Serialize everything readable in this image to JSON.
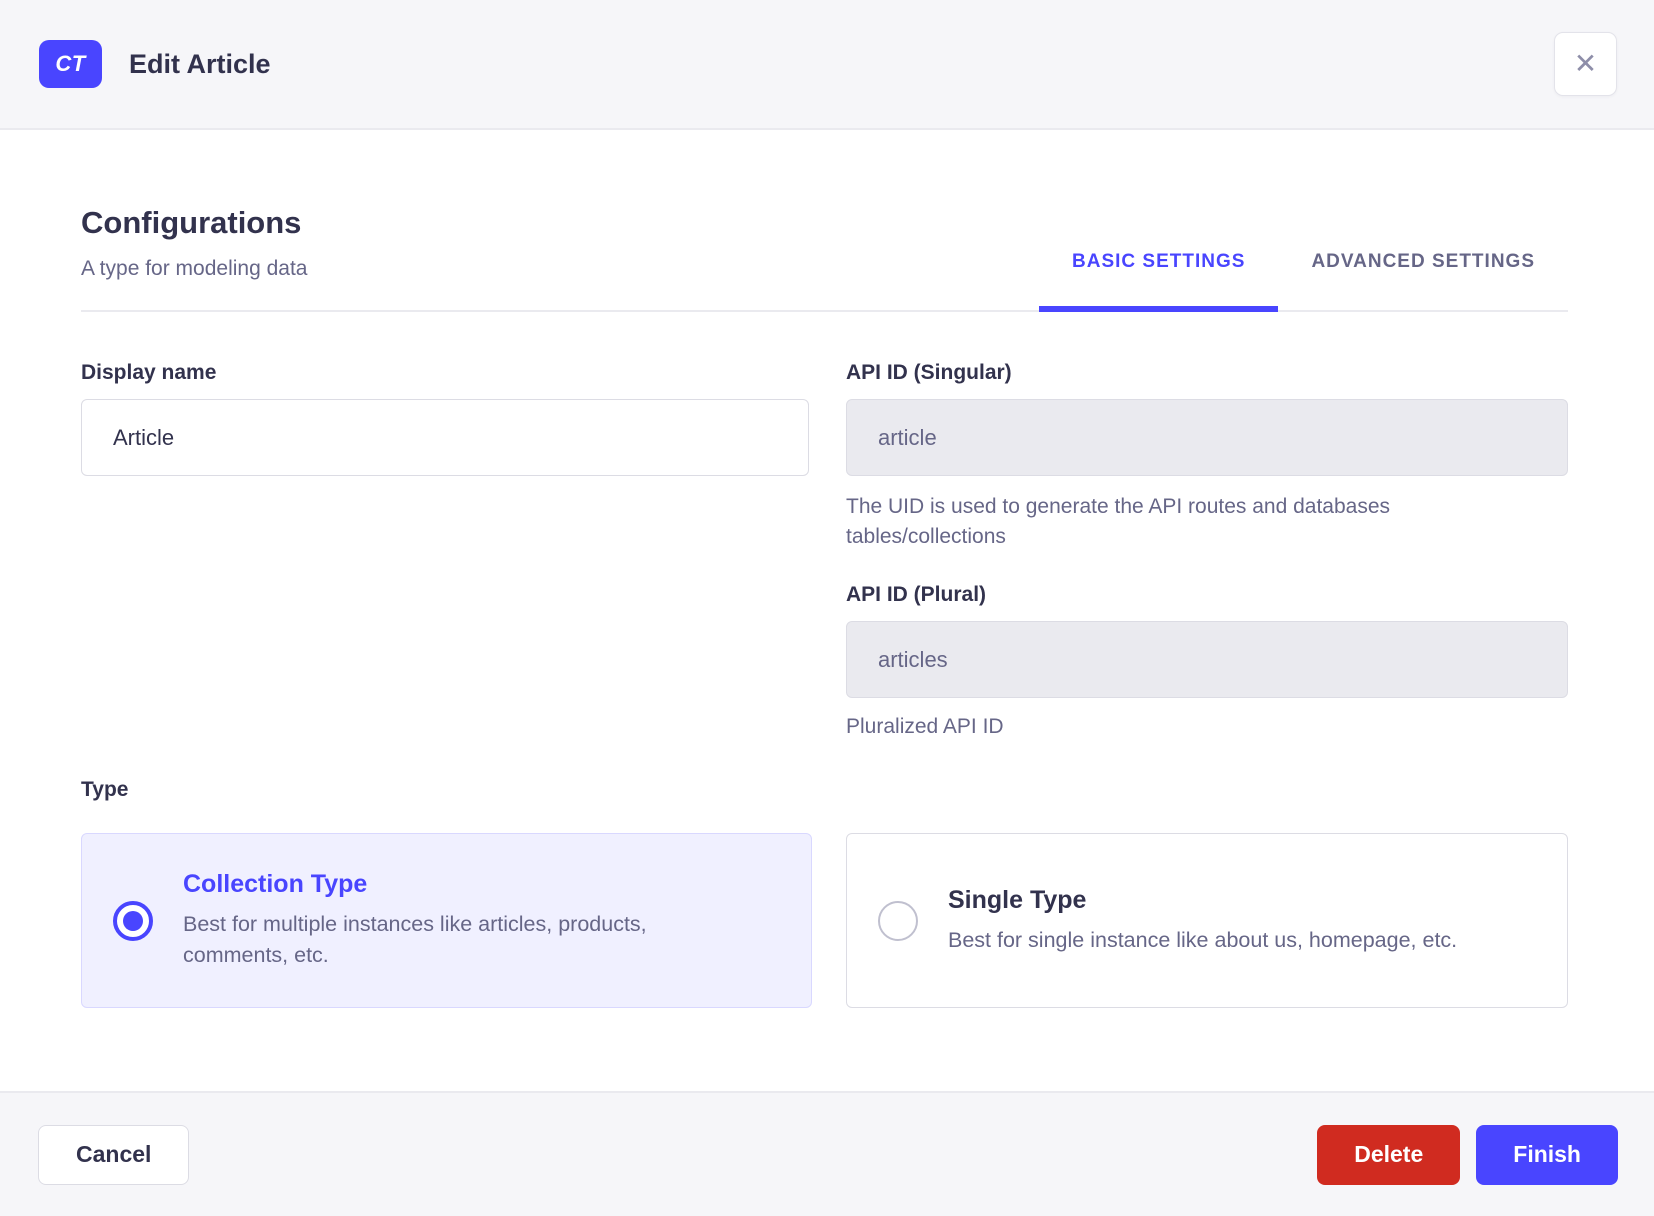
{
  "modal": {
    "badge_text": "CT",
    "title": "Edit Article",
    "close_glyph": "✕"
  },
  "heading": {
    "title": "Configurations",
    "subtitle": "A type for modeling data"
  },
  "tabs": [
    {
      "label": "BASIC SETTINGS",
      "active": true
    },
    {
      "label": "ADVANCED SETTINGS",
      "active": false
    }
  ],
  "form": {
    "display_name": {
      "label": "Display name",
      "value": "Article"
    },
    "api_id_singular": {
      "label": "API ID (Singular)",
      "value": "article",
      "hint": "The UID is used to generate the API routes and databases tables/collections"
    },
    "api_id_plural": {
      "label": "API ID (Plural)",
      "value": "articles",
      "hint": "Pluralized API ID"
    },
    "type": {
      "label": "Type",
      "options": [
        {
          "title": "Collection Type",
          "description": "Best for multiple instances like articles, products, comments, etc.",
          "selected": true
        },
        {
          "title": "Single Type",
          "description": "Best for single instance like about us, homepage, etc.",
          "selected": false
        }
      ]
    }
  },
  "footer": {
    "cancel_label": "Cancel",
    "delete_label": "Delete",
    "finish_label": "Finish"
  },
  "colors": {
    "primary": "#4945ff",
    "danger": "#d02b20",
    "text": "#32324d",
    "muted_text": "#666687",
    "header_bg": "#f6f6f9",
    "divider": "#eaeaef",
    "control_border": "#dcdce4",
    "disabled_input_bg": "#eaeaef",
    "selected_card_bg": "#f0f0ff",
    "selected_card_border": "#d9d8ff"
  }
}
